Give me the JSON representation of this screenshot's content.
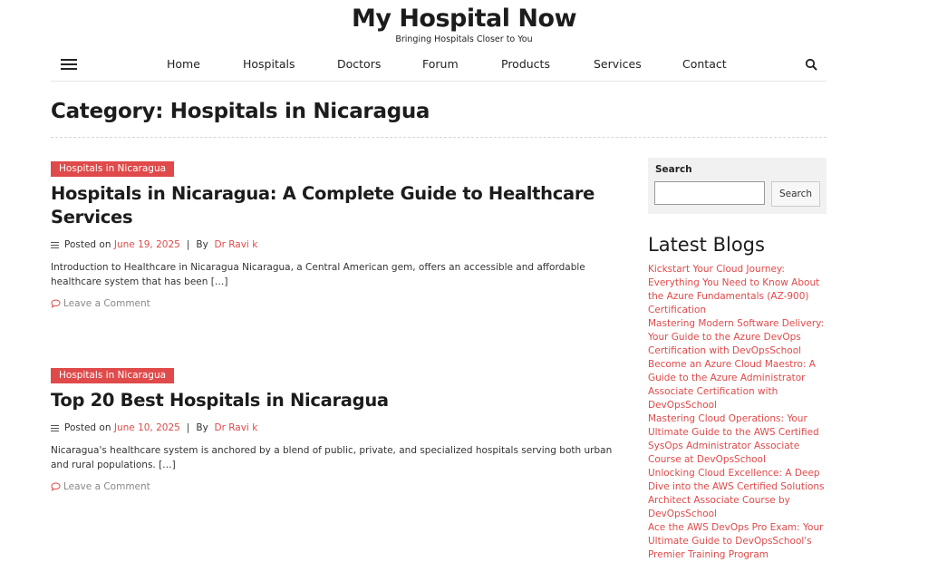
{
  "site": {
    "title": "My Hospital Now",
    "tagline": "Bringing Hospitals Closer to You"
  },
  "nav": {
    "items": [
      "Home",
      "Hospitals",
      "Doctors",
      "Forum",
      "Products",
      "Services",
      "Contact"
    ]
  },
  "page": {
    "title": "Category: Hospitals in Nicaragua"
  },
  "posts": [
    {
      "category": "Hospitals in Nicaragua",
      "title": "Hospitals in Nicaragua: A Complete Guide to Healthcare Services",
      "posted_on_label": "Posted on",
      "date": "June 19, 2025",
      "separator": "|",
      "by_label": "By",
      "author": "Dr Ravi k",
      "excerpt": "Introduction to Healthcare in Nicaragua Nicaragua, a Central American gem, offers an accessible and affordable healthcare system that has been […]",
      "comment_label": "Leave a Comment"
    },
    {
      "category": "Hospitals in Nicaragua",
      "title": "Top 20 Best Hospitals in Nicaragua",
      "posted_on_label": "Posted on",
      "date": "June 10, 2025",
      "separator": "|",
      "by_label": "By",
      "author": "Dr Ravi k",
      "excerpt": "Nicaragua's healthcare system is anchored by a blend of public, private, and specialized hospitals serving both urban and rural populations. […]",
      "comment_label": "Leave a Comment"
    }
  ],
  "sidebar": {
    "search_label": "Search",
    "search_value": "",
    "search_button": "Search",
    "latest_heading": "Latest Blogs",
    "latest": [
      "Kickstart Your Cloud Journey: Everything You Need to Know About the Azure Fundamentals (AZ-900) Certification",
      "Mastering Modern Software Delivery: Your Guide to the Azure DevOps Certification with DevOpsSchool",
      "Become an Azure Cloud Maestro: A Guide to the Azure Administrator Associate Certification with DevOpsSchool",
      "Mastering Cloud Operations: Your Ultimate Guide to the AWS Certified SysOps Administrator Associate Course at DevOpsSchool",
      "Unlocking Cloud Excellence: A Deep Dive into the AWS Certified Solutions Architect Associate Course by DevOpsSchool",
      "Ace the AWS DevOps Pro Exam: Your Ultimate Guide to DevOpsSchool's Premier Training Program"
    ]
  },
  "icons": {
    "menu": "hamburger-icon",
    "search": "search-icon",
    "meta": "list-icon",
    "comment": "comment-icon"
  },
  "colors": {
    "accent": "#e04a4a",
    "text": "#1c1c1c",
    "sidebar_bg": "#f1f1f1"
  }
}
